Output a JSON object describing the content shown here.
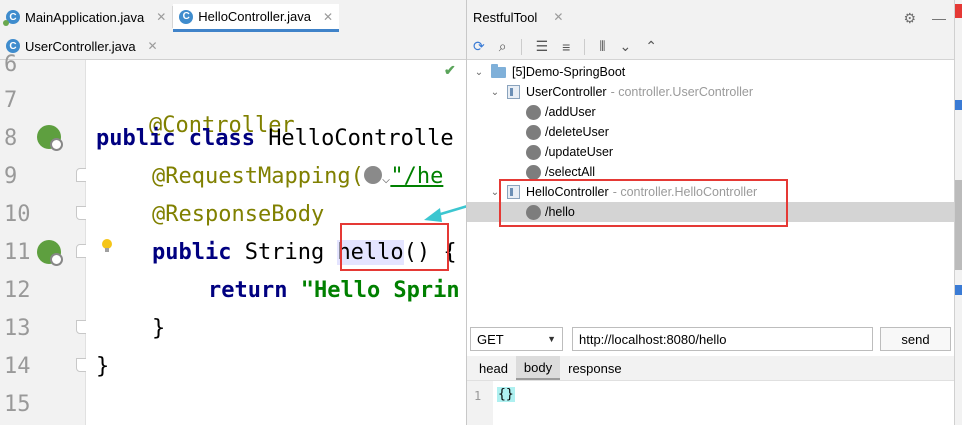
{
  "editor": {
    "tabs": [
      {
        "label": "MainApplication.java",
        "icon": "class-icon",
        "active": false
      },
      {
        "label": "HelloController.java",
        "icon": "class-icon",
        "active": true
      },
      {
        "label": "UserController.java",
        "icon": "class-icon",
        "active": false
      }
    ],
    "line_numbers": [
      "6",
      "7",
      "8",
      "9",
      "10",
      "11",
      "12",
      "13",
      "14",
      "15"
    ],
    "code": {
      "l7": "@Controller",
      "l8_kw": "public class ",
      "l8_name": "HelloControlle",
      "l9_anno": "@RequestMapping(",
      "l9_str": "\"/he",
      "l10": "@ResponseBody",
      "l11_kw": "public ",
      "l11_type": "String ",
      "l11_method": "hello",
      "l11_parens": "()",
      "l11_tail": " {",
      "l12_kw": "return ",
      "l12_str": "\"Hello Sprin",
      "l13": "}",
      "l14": "}"
    }
  },
  "restful_tool": {
    "title": "RestfulTool",
    "tree": {
      "project": "[5]Demo-SpringBoot",
      "controllers": [
        {
          "name": "UserController",
          "package": "- controller.UserController",
          "endpoints": [
            "/addUser",
            "/deleteUser",
            "/updateUser",
            "/selectAll"
          ]
        },
        {
          "name": "HelloController",
          "package": "- controller.HelloController",
          "endpoints": [
            "/hello"
          ]
        }
      ]
    },
    "request": {
      "method": "GET",
      "url": "http://localhost:8080/hello",
      "send_label": "send"
    },
    "tabs": [
      "head",
      "body",
      "response"
    ],
    "active_tab": "body",
    "body": {
      "line": "1",
      "content": "{}"
    }
  },
  "colors": {
    "highlight_box": "#e53935",
    "tab_accent": "#4083c9",
    "annotation": "#808000",
    "keyword": "#000080",
    "string": "#008000"
  }
}
